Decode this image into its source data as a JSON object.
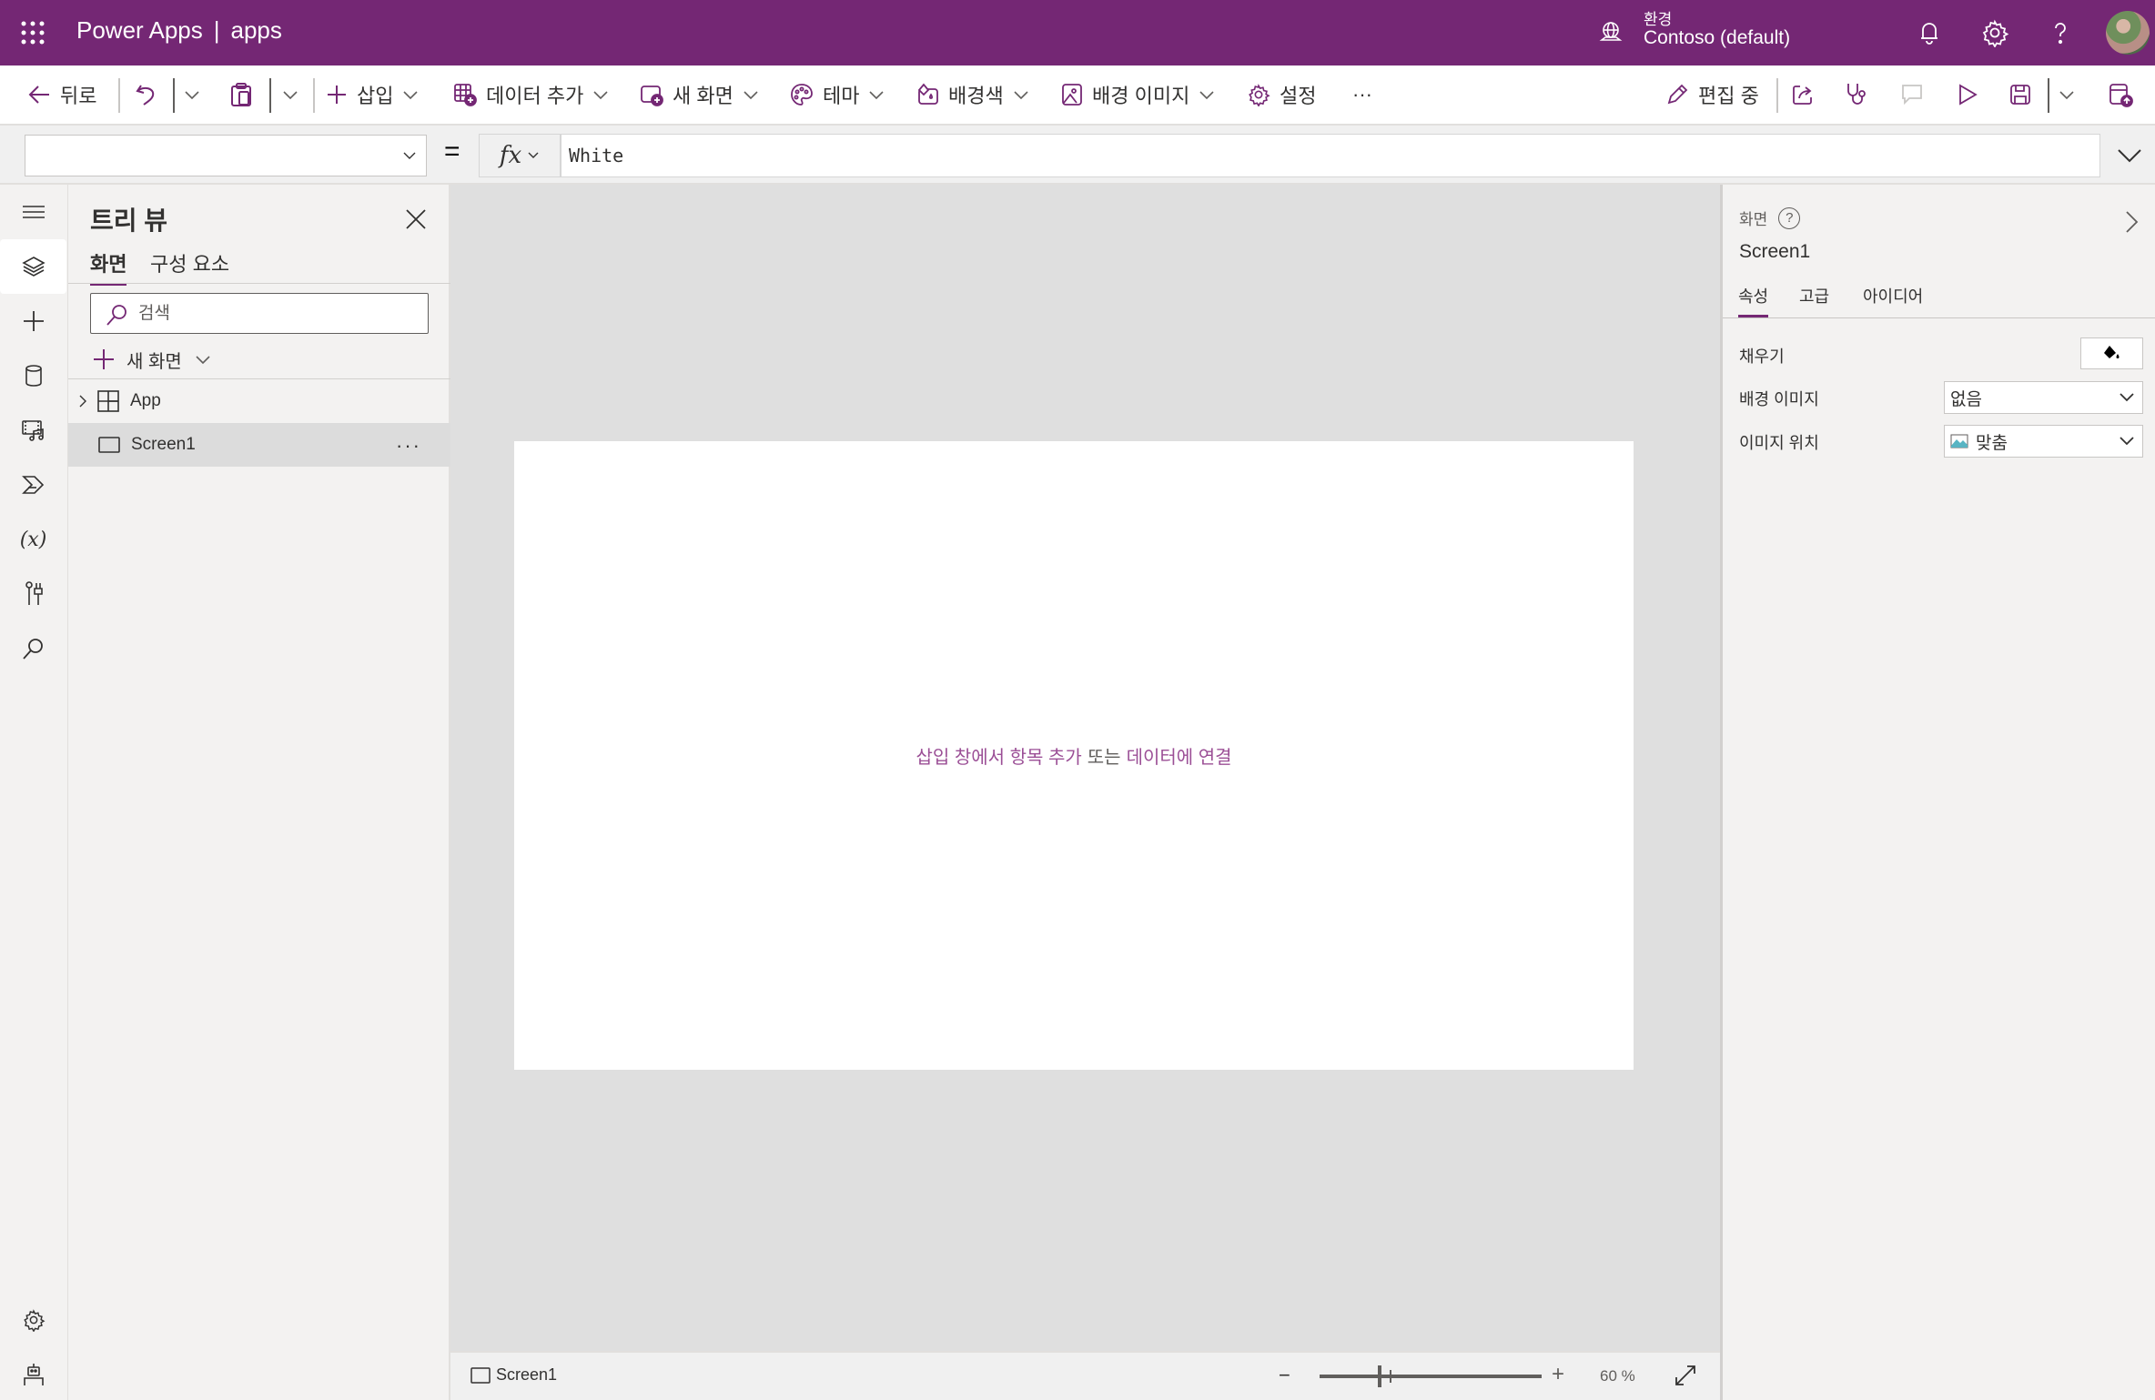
{
  "header": {
    "product": "Power Apps",
    "separator": "|",
    "app_name": "apps",
    "environment_label": "환경",
    "environment_name": "Contoso (default)",
    "brand_color": "#742774"
  },
  "toolbar": {
    "back": "뒤로",
    "insert": "삽입",
    "add_data": "데이터 추가",
    "new_screen": "새 화면",
    "theme": "테마",
    "background_color": "배경색",
    "background_image": "배경 이미지",
    "settings": "설정",
    "more": "···",
    "editing": "편집 중"
  },
  "formula_bar": {
    "property": "",
    "equals": "=",
    "fx": "fx",
    "formula": "White"
  },
  "tree_view": {
    "title": "트리 뷰",
    "tabs": [
      {
        "label": "화면",
        "active": true
      },
      {
        "label": "구성 요소",
        "active": false
      }
    ],
    "search_placeholder": "검색",
    "new_screen": "새 화면",
    "items": [
      {
        "label": "App",
        "expandable": true,
        "selected": false
      },
      {
        "label": "Screen1",
        "expandable": false,
        "selected": true,
        "more": "···"
      }
    ]
  },
  "canvas": {
    "hint_link1": "삽입 창에서 항목 추가",
    "hint_or": "또는",
    "hint_link2": "데이터에 연결"
  },
  "status_bar": {
    "screen_name": "Screen1",
    "zoom_minus": "−",
    "zoom_plus": "+",
    "zoom_percent": 60,
    "zoom_label": "60 %"
  },
  "properties": {
    "kind": "화면",
    "help": "?",
    "name": "Screen1",
    "tabs": [
      {
        "label": "속성",
        "active": true
      },
      {
        "label": "고급",
        "active": false
      },
      {
        "label": "아이디어",
        "active": false
      }
    ],
    "fill_label": "채우기",
    "fill_value": "#FFFFFF",
    "bg_image_label": "배경 이미지",
    "bg_image_value": "없음",
    "image_position_label": "이미지 위치",
    "image_position_value": "맞춤"
  }
}
